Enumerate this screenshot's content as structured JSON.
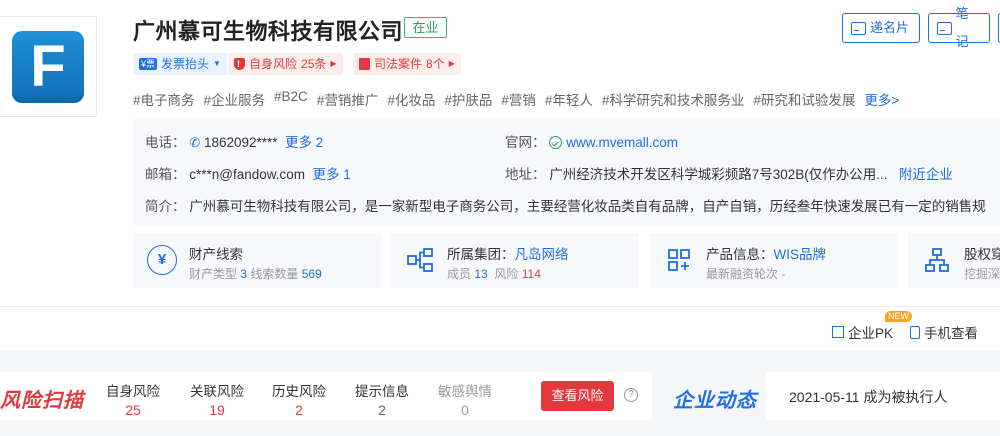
{
  "logo": {
    "letter": "F",
    "color": "#1677c7"
  },
  "company": {
    "name": "广州慕可生物科技有限公司",
    "status": "在业"
  },
  "actions": {
    "card": "递名片",
    "note": "笔记"
  },
  "badges": {
    "invoice": {
      "mini": "¥票",
      "label": "发票抬头"
    },
    "risk": {
      "label": "自身风险",
      "count": "25条"
    },
    "court": {
      "label": "司法案件",
      "count": "8个"
    }
  },
  "tags": [
    "#电子商务",
    "#企业服务",
    "#B2C",
    "#营销推广",
    "#化妆品",
    "#护肤品",
    "#营销",
    "#年轻人",
    "#科学研究和技术服务业",
    "#研究和试验发展"
  ],
  "tags_more": "更多>",
  "info": {
    "phone_label": "电话：",
    "phone": "1862092****",
    "phone_more": "更多 2",
    "site_label": "官网：",
    "site": "www.mvemall.com",
    "email_label": "邮箱：",
    "email": "c***n@fandow.com",
    "email_more": "更多 1",
    "addr_label": "地址：",
    "addr": "广州经济技术开发区科学城彩频路7号302B(仅作办公用...",
    "addr_near": "附近企业",
    "intro_label": "简介：",
    "intro": "广州慕可生物科技有限公司，是一家新型电子商务公司，主要经营化妆品类自有品牌，自产自销，历经叁年快速发展已有一定的销售规"
  },
  "cards": {
    "asset": {
      "title": "财产线索",
      "sub_a": "财产类型",
      "sub_a_val": "3",
      "sub_b": "线索数量",
      "sub_b_val": "569"
    },
    "group": {
      "title": "所属集团：",
      "title_val": "凡岛网络",
      "sub_a": "成员",
      "sub_a_val": "13",
      "sub_b": "风险",
      "sub_b_val": "114"
    },
    "product": {
      "title": "产品信息：",
      "title_val": "WIS品牌",
      "sub": "最新融资轮次 -"
    },
    "equity": {
      "title": "股权穿",
      "sub": "挖掘深"
    }
  },
  "tools": {
    "pk": "企业PK",
    "new": "NEW",
    "mobile": "手机查看"
  },
  "scan": {
    "title": "风险扫描",
    "stats": [
      {
        "label": "自身风险",
        "value": "25"
      },
      {
        "label": "关联风险",
        "value": "19"
      },
      {
        "label": "历史风险",
        "value": "2"
      },
      {
        "label": "提示信息",
        "value": "2"
      },
      {
        "label": "敏感舆情",
        "value": "0"
      }
    ],
    "button": "查看风险",
    "help": "?"
  },
  "dynamics": {
    "title": "企业动态",
    "item": "2021-05-11 成为被执行人"
  }
}
